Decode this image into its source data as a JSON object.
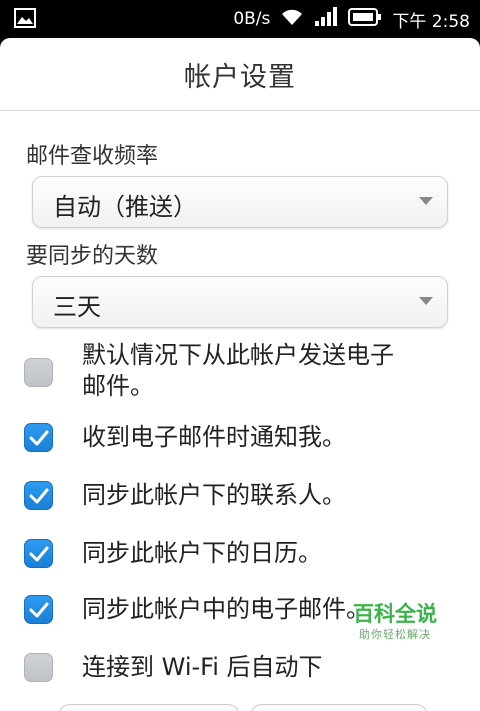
{
  "status_bar": {
    "data_rate": "0B/s",
    "time": "下午 2:58",
    "icons": [
      "image-icon",
      "wifi-icon",
      "signal-icon",
      "battery-icon"
    ]
  },
  "header": {
    "title": "帐户设置"
  },
  "check_frequency": {
    "label": "邮件查收频率",
    "value": "自动（推送）"
  },
  "sync_days": {
    "label": "要同步的天数",
    "value": "三天"
  },
  "options": [
    {
      "label": "默认情况下从此帐户发送电子\n邮件。",
      "checked": false
    },
    {
      "label": "收到电子邮件时通知我。",
      "checked": true
    },
    {
      "label": "同步此帐户下的联系人。",
      "checked": true
    },
    {
      "label": "同步此帐户下的日历。",
      "checked": true
    },
    {
      "label": "同步此帐户中的电子邮件。",
      "checked": true
    },
    {
      "label": "连接到 Wi-Fi 后自动下",
      "checked": false
    }
  ],
  "watermark": {
    "title": "百科全说",
    "subtitle": "助你轻松解决"
  },
  "colors": {
    "accent": "#1b7fd6",
    "unchecked": "#c4c7cb",
    "watermark": "#3cb34a"
  }
}
